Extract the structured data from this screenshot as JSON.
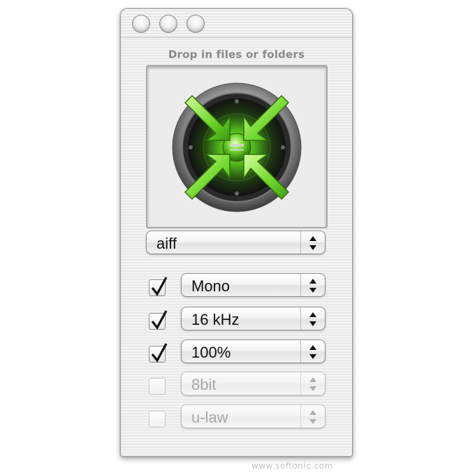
{
  "window": {
    "buttons": [
      {
        "name": "close-button",
        "icon": "window-close-icon"
      },
      {
        "name": "minimize-button",
        "icon": "window-minimize-icon"
      },
      {
        "name": "zoom-button",
        "icon": "window-zoom-icon"
      }
    ]
  },
  "drop_zone": {
    "label": "Drop in files or folders",
    "icon": "speaker-drop-target-icon"
  },
  "format_popup": {
    "value": "aiff"
  },
  "options": [
    {
      "checked": true,
      "enabled": true,
      "value": "Mono"
    },
    {
      "checked": true,
      "enabled": true,
      "value": "16 kHz"
    },
    {
      "checked": true,
      "enabled": true,
      "value": "100%"
    },
    {
      "checked": false,
      "enabled": false,
      "value": "8bit"
    },
    {
      "checked": false,
      "enabled": false,
      "value": "u-law"
    }
  ],
  "watermark": "www.softonic.com",
  "colors": {
    "accent_green": "#5fd21f",
    "window_bg": "#eeeeee",
    "disabled_text": "#a8a8a8"
  }
}
